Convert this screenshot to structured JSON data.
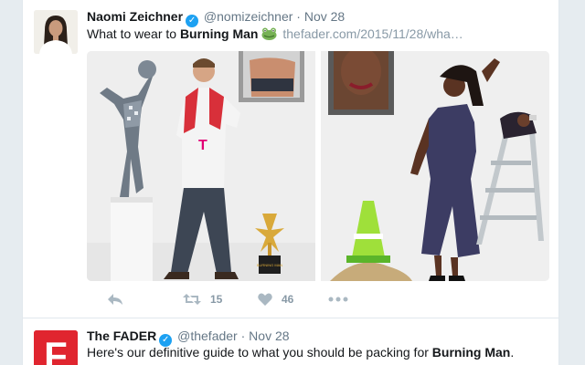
{
  "tweets": [
    {
      "name": "Naomi Zeichner",
      "handle": "@nomizeichner",
      "separator": "·",
      "date": "Nov 28",
      "text_prefix": "What to wear to ",
      "text_bold": "Burning Man",
      "emoji_icon": "frog-face-icon",
      "link": "thefader.com/2015/11/28/wha…",
      "actions": {
        "reply": "",
        "retweet_count": "15",
        "like_count": "46",
        "more": ""
      },
      "media": [
        {
          "description_icon": "photo-people-left"
        },
        {
          "description_icon": "photo-people-right"
        }
      ],
      "trophy_label": "BURNING MAN"
    },
    {
      "name": "The FADER",
      "handle": "@thefader",
      "separator": "·",
      "date": "Nov 28",
      "avatar_letter": "F",
      "text_prefix": "Here's our definitive guide to what you should be packing for ",
      "text_bold": "Burning Man",
      "text_suffix": "."
    }
  ],
  "colors": {
    "accent": "#1da1f2",
    "page_bg": "#e6ecf0",
    "fader_red": "#e0252f",
    "muted": "#8899a6"
  }
}
